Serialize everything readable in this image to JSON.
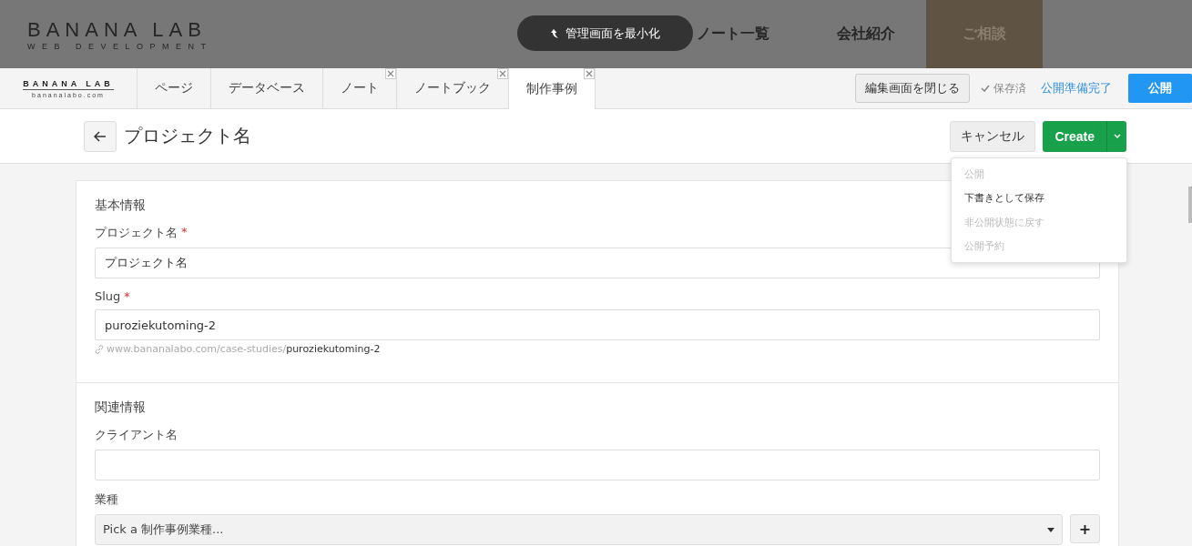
{
  "site_header": {
    "logo": "BANANA LAB",
    "tagline": "WEB DEVELOPMENT",
    "nav": [
      {
        "label": "ノート一覧",
        "kind": "link"
      },
      {
        "label": "会社紹介",
        "kind": "link"
      },
      {
        "label": "ご相談",
        "kind": "cta"
      }
    ],
    "minimize_button": "管理画面を最小化"
  },
  "admin_bar": {
    "logo": "BANANA LAB",
    "logo_domain": "bananalabo.com",
    "tabs": [
      {
        "label": "ページ",
        "selected": false,
        "closable": false
      },
      {
        "label": "データベース",
        "selected": false,
        "closable": false
      },
      {
        "label": "ノート",
        "selected": false,
        "closable": true
      },
      {
        "label": "ノートブック",
        "selected": false,
        "closable": true
      },
      {
        "label": "制作事例",
        "selected": true,
        "closable": true
      }
    ],
    "close_editor_button": "編集画面を閉じる",
    "save_status": "保存済",
    "ready_link": "公開準備完了",
    "publish_button": "公開"
  },
  "editor_header": {
    "title": "プロジェクト名",
    "cancel_button": "キャンセル",
    "create_button": "Create",
    "menu": [
      {
        "label": "公開",
        "disabled": true
      },
      {
        "label": "下書きとして保存",
        "disabled": false
      },
      {
        "label": "非公開状態に戻す",
        "disabled": true
      },
      {
        "label": "公開予約",
        "disabled": true
      }
    ]
  },
  "sections": [
    {
      "title": "基本情報",
      "fields": [
        {
          "kind": "text",
          "label": "プロジェクト名",
          "required_mark": "*",
          "value": "プロジェクト名"
        },
        {
          "kind": "text",
          "label": "Slug",
          "required_mark": "*",
          "value": "puroziekutoming-2",
          "url_base": "www.bananalabo.com/case-studies/",
          "url_slug": "puroziekutoming-2"
        }
      ]
    },
    {
      "title": "関連情報",
      "fields": [
        {
          "kind": "text",
          "label": "クライアント名"
        },
        {
          "kind": "select",
          "label": "業種",
          "placeholder": "Pick a 制作事例業種...",
          "add_button": "+"
        }
      ]
    }
  ]
}
